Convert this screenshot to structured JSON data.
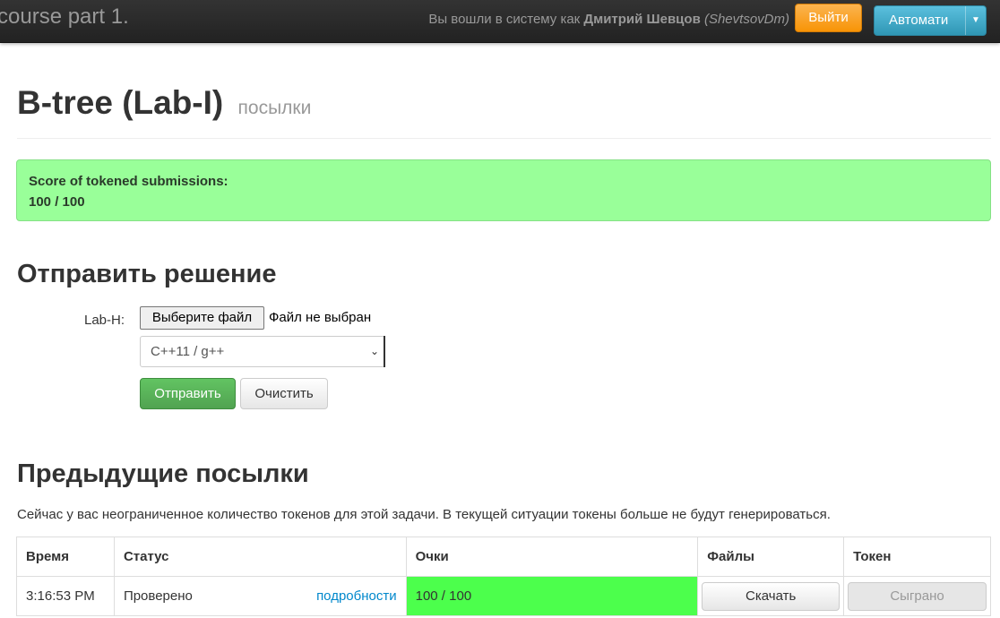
{
  "navbar": {
    "brand": "course part 1.",
    "login_prefix": "Вы вошли в систему как",
    "user_name": "Дмитрий Шевцов",
    "user_login": "(ShevtsovDm)",
    "logout_label": "Выйти",
    "language_label": "Автомати"
  },
  "header": {
    "title": "B-tree (Lab-I)",
    "subtitle": "посылки"
  },
  "score_alert": {
    "label": "Score of tokened submissions:",
    "value": "100 / 100"
  },
  "submit_section": {
    "heading": "Отправить решение",
    "file_label": "Lab-H:",
    "choose_file_label": "Выберите файл",
    "file_status": "Файл не выбран",
    "language_selected": "C++11 / g++",
    "submit_label": "Отправить",
    "clear_label": "Очистить"
  },
  "previous_section": {
    "heading": "Предыдущие посылки",
    "tokens_note": "Сейчас у вас неограниченное количество токенов для этой задачи. В текущей ситуации токены больше не будут генерироваться.",
    "columns": [
      "Время",
      "Статус",
      "Очки",
      "Файлы",
      "Токен"
    ],
    "rows": [
      {
        "time": "3:16:53 PM",
        "status": "Проверено",
        "details_label": "подробности",
        "score": "100 / 100",
        "download_label": "Скачать",
        "token_label": "Сыграно"
      }
    ]
  },
  "colors": {
    "navbar_bg": "#222222",
    "logout": "#f89406",
    "language": "#2f96b4",
    "score_alert_bg": "#99ff99",
    "submit": "#51a351",
    "score_cell": "#4cff4c",
    "link": "#0088cc"
  }
}
